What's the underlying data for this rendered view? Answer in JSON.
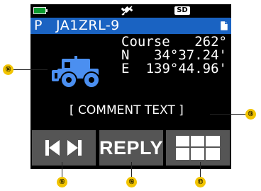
{
  "status_bar": {
    "battery_icon": "battery-full-icon",
    "gps_icon": "gps-off-icon",
    "sd_label": "SD"
  },
  "title_bar": {
    "mode": "P",
    "callsign": "JA1ZRL-9",
    "document_icon": "document-icon",
    "color": "#1a63c2"
  },
  "station": {
    "icon": "jeep-icon",
    "course_label": "Course",
    "course_value": "262°",
    "lat_label": "N",
    "lat_value": "34°37.24'",
    "lon_label": "E",
    "lon_value": "139°44.96'"
  },
  "comment": "[ COMMENT TEXT ]",
  "softkeys": [
    {
      "label": "",
      "icon": "skip-prev-next-icon"
    },
    {
      "label": "REPLY",
      "icon": ""
    },
    {
      "label": "",
      "icon": "grid-menu-icon"
    }
  ],
  "callouts": {
    "station_icon": "⑭",
    "comment": "⑬",
    "prev_next": "⑮",
    "reply": "⑯",
    "menu": "⑰"
  },
  "colors": {
    "screen_bg": "#000000",
    "softkey_bg": "#555555",
    "icon_blue": "#4b8ff0",
    "callout": "#f2c400",
    "battery": "#0a9a2e"
  }
}
